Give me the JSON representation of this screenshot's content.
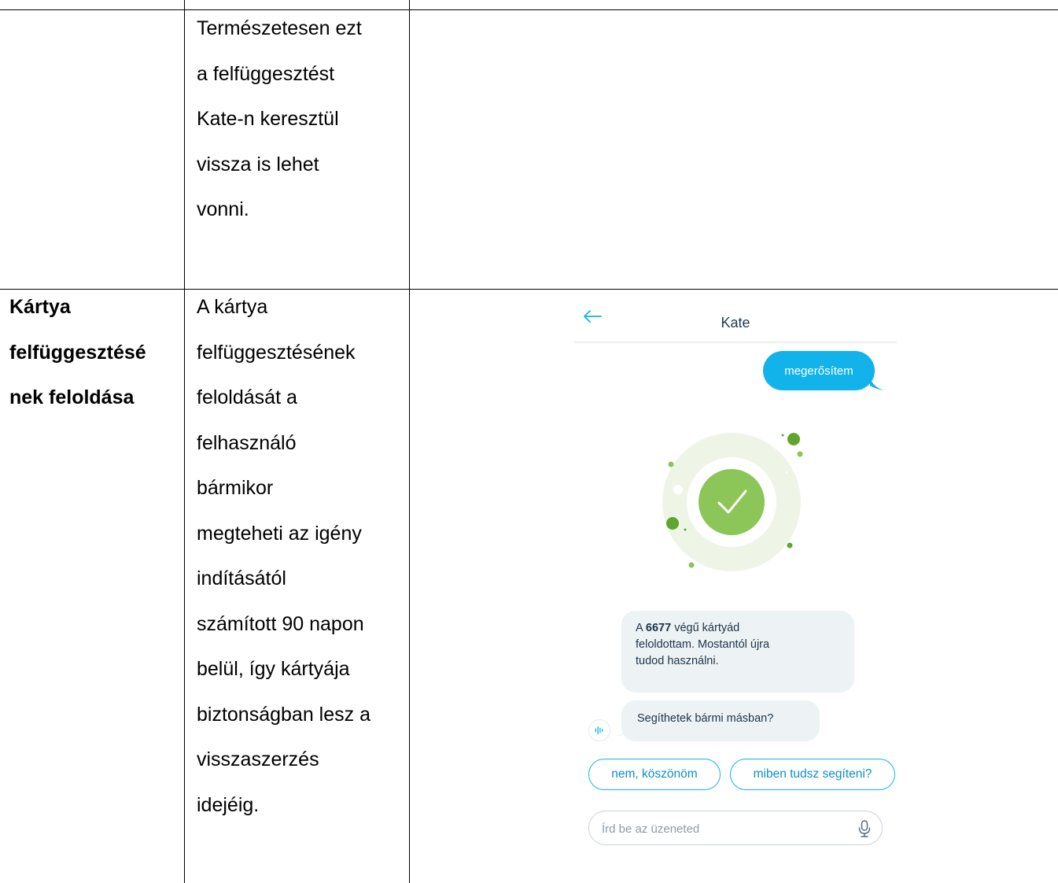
{
  "row1": {
    "desc_lines": [
      "Természetesen ezt",
      "a felfüggesztést",
      "Kate-n keresztül",
      "vissza is lehet",
      "vonni."
    ]
  },
  "row2": {
    "title_lines": [
      "Kártya",
      "felfüggesztésé",
      "nek feloldása"
    ],
    "desc_lines": [
      "A kártya",
      "felfüggesztésének",
      "feloldását a",
      "felhasználó",
      "bármikor",
      "megteheti az igény",
      "indításától",
      "számított 90 napon",
      "belül, így kártyája",
      "biztonságban lesz a",
      "visszaszerzés",
      "idejéig."
    ]
  },
  "chat": {
    "title": "Kate",
    "user_message": "megerősítem",
    "bot_message1": {
      "prefix": "A ",
      "card_number": "6677",
      "line1_suffix": " végű kártyád",
      "line2": "feloldottam. Mostantól újra",
      "line3": "tudod használni."
    },
    "bot_message2": "Segíthetek bármi másban?",
    "quick_replies": [
      "nem, köszönöm",
      "miben tudsz segíteni?"
    ],
    "input_placeholder": "Írd be az üzeneted",
    "icons": {
      "back": "arrow-left-icon",
      "success": "checkmark-icon",
      "avatar": "voice-wave-icon",
      "mic": "microphone-icon"
    },
    "colors": {
      "accent": "#11b3ea",
      "success": "#7dbf3f",
      "bubble": "#edf2f5",
      "title": "#1c3a56"
    }
  }
}
